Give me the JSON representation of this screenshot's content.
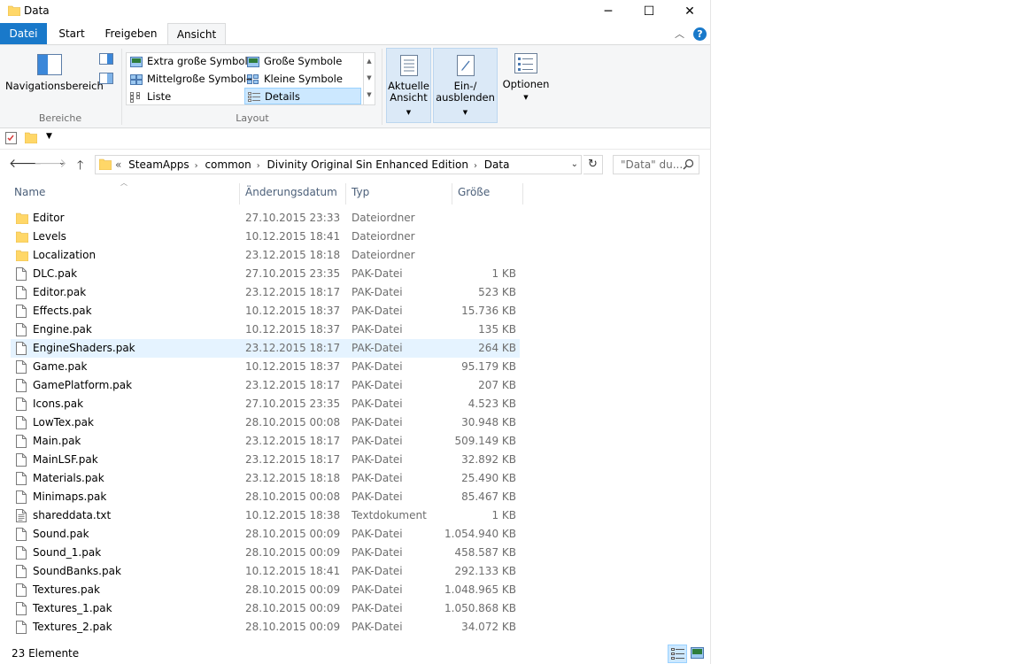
{
  "window": {
    "title": "Data",
    "controls": {
      "minimize": "─",
      "maximize": "☐",
      "close": "✕"
    }
  },
  "ribbon": {
    "tabs": [
      {
        "label": "Datei"
      },
      {
        "label": "Start"
      },
      {
        "label": "Freigeben"
      },
      {
        "label": "Ansicht"
      }
    ],
    "groups": {
      "bereiche": {
        "label": "Bereiche",
        "navigation_pane": "Navigationsbereich"
      },
      "layout": {
        "label": "Layout",
        "views": [
          {
            "label": "Extra große Symbole"
          },
          {
            "label": "Große Symbole"
          },
          {
            "label": "Mittelgroße Symbole"
          },
          {
            "label": "Kleine Symbole"
          },
          {
            "label": "Liste"
          },
          {
            "label": "Details"
          }
        ],
        "selected_view": "Details"
      },
      "current_view": {
        "line1": "Aktuelle",
        "line2": "Ansicht"
      },
      "show_hide": {
        "line1": "Ein-/",
        "line2": "ausblenden"
      },
      "options": {
        "label": "Optionen"
      }
    }
  },
  "address_bar": {
    "overflow": "«",
    "crumbs": [
      "SteamApps",
      "common",
      "Divinity Original Sin Enhanced Edition",
      "Data"
    ],
    "search_placeholder": "\"Data\" du..."
  },
  "columns": {
    "name": "Name",
    "date": "Änderungsdatum",
    "type": "Typ",
    "size": "Größe"
  },
  "files": [
    {
      "name": "Editor",
      "date": "27.10.2015 23:33",
      "type": "Dateiordner",
      "size": "",
      "kind": "folder"
    },
    {
      "name": "Levels",
      "date": "10.12.2015 18:41",
      "type": "Dateiordner",
      "size": "",
      "kind": "folder"
    },
    {
      "name": "Localization",
      "date": "23.12.2015 18:18",
      "type": "Dateiordner",
      "size": "",
      "kind": "folder"
    },
    {
      "name": "DLC.pak",
      "date": "27.10.2015 23:35",
      "type": "PAK-Datei",
      "size": "1 KB",
      "kind": "file"
    },
    {
      "name": "Editor.pak",
      "date": "23.12.2015 18:17",
      "type": "PAK-Datei",
      "size": "523 KB",
      "kind": "file"
    },
    {
      "name": "Effects.pak",
      "date": "10.12.2015 18:37",
      "type": "PAK-Datei",
      "size": "15.736 KB",
      "kind": "file"
    },
    {
      "name": "Engine.pak",
      "date": "10.12.2015 18:37",
      "type": "PAK-Datei",
      "size": "135 KB",
      "kind": "file"
    },
    {
      "name": "EngineShaders.pak",
      "date": "23.12.2015 18:17",
      "type": "PAK-Datei",
      "size": "264 KB",
      "kind": "file",
      "hover": true
    },
    {
      "name": "Game.pak",
      "date": "10.12.2015 18:37",
      "type": "PAK-Datei",
      "size": "95.179 KB",
      "kind": "file"
    },
    {
      "name": "GamePlatform.pak",
      "date": "23.12.2015 18:17",
      "type": "PAK-Datei",
      "size": "207 KB",
      "kind": "file"
    },
    {
      "name": "Icons.pak",
      "date": "27.10.2015 23:35",
      "type": "PAK-Datei",
      "size": "4.523 KB",
      "kind": "file"
    },
    {
      "name": "LowTex.pak",
      "date": "28.10.2015 00:08",
      "type": "PAK-Datei",
      "size": "30.948 KB",
      "kind": "file"
    },
    {
      "name": "Main.pak",
      "date": "23.12.2015 18:17",
      "type": "PAK-Datei",
      "size": "509.149 KB",
      "kind": "file"
    },
    {
      "name": "MainLSF.pak",
      "date": "23.12.2015 18:17",
      "type": "PAK-Datei",
      "size": "32.892 KB",
      "kind": "file"
    },
    {
      "name": "Materials.pak",
      "date": "23.12.2015 18:18",
      "type": "PAK-Datei",
      "size": "25.490 KB",
      "kind": "file"
    },
    {
      "name": "Minimaps.pak",
      "date": "28.10.2015 00:08",
      "type": "PAK-Datei",
      "size": "85.467 KB",
      "kind": "file"
    },
    {
      "name": "shareddata.txt",
      "date": "10.12.2015 18:38",
      "type": "Textdokument",
      "size": "1 KB",
      "kind": "text"
    },
    {
      "name": "Sound.pak",
      "date": "28.10.2015 00:09",
      "type": "PAK-Datei",
      "size": "1.054.940 KB",
      "kind": "file"
    },
    {
      "name": "Sound_1.pak",
      "date": "28.10.2015 00:09",
      "type": "PAK-Datei",
      "size": "458.587 KB",
      "kind": "file"
    },
    {
      "name": "SoundBanks.pak",
      "date": "10.12.2015 18:41",
      "type": "PAK-Datei",
      "size": "292.133 KB",
      "kind": "file"
    },
    {
      "name": "Textures.pak",
      "date": "28.10.2015 00:09",
      "type": "PAK-Datei",
      "size": "1.048.965 KB",
      "kind": "file"
    },
    {
      "name": "Textures_1.pak",
      "date": "28.10.2015 00:09",
      "type": "PAK-Datei",
      "size": "1.050.868 KB",
      "kind": "file"
    },
    {
      "name": "Textures_2.pak",
      "date": "28.10.2015 00:09",
      "type": "PAK-Datei",
      "size": "34.072 KB",
      "kind": "file"
    }
  ],
  "status_bar": {
    "item_count": "23 Elemente"
  },
  "colors": {
    "accent": "#1979ca",
    "folder": "#ffd768",
    "hover": "#e5f3ff",
    "selected": "#cce8ff"
  }
}
